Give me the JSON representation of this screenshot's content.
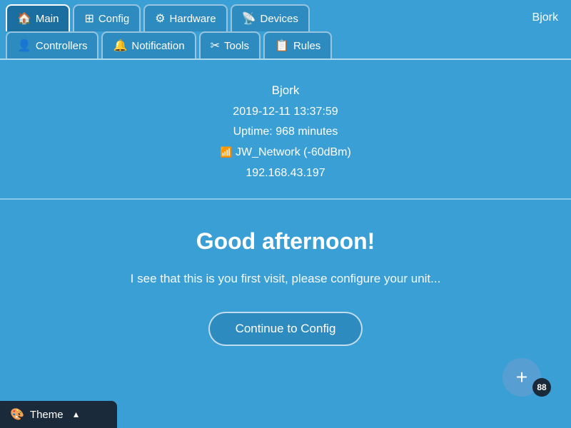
{
  "nav": {
    "top_tabs": [
      {
        "id": "main",
        "label": "Main",
        "icon": "🏠",
        "active": true
      },
      {
        "id": "config",
        "label": "Config",
        "icon": "⊞",
        "active": false
      },
      {
        "id": "hardware",
        "label": "Hardware",
        "icon": "⚙",
        "active": false
      },
      {
        "id": "devices",
        "label": "Devices",
        "icon": "📡",
        "active": false
      }
    ],
    "username": "Bjork",
    "bottom_tabs": [
      {
        "id": "controllers",
        "label": "Controllers",
        "icon": "👤"
      },
      {
        "id": "notification",
        "label": "Notification",
        "icon": "🔔"
      },
      {
        "id": "tools",
        "label": "Tools",
        "icon": "✂"
      },
      {
        "id": "rules",
        "label": "Rules",
        "icon": "📋"
      }
    ]
  },
  "info": {
    "device_name": "Bjork",
    "datetime": "2019-12-11 13:37:59",
    "uptime": "Uptime: 968 minutes",
    "network": "JW_Network (-60dBm)",
    "ip": "192.168.43.197"
  },
  "main": {
    "greeting": "Good afternoon!",
    "sub_text": "I see that this is you first visit, please configure your unit...",
    "config_button_label": "Continue to Config"
  },
  "theme_bar": {
    "label": "Theme",
    "arrow": "▲",
    "icon": "🎨"
  },
  "fab": {
    "icon": "+",
    "badge": "88"
  }
}
